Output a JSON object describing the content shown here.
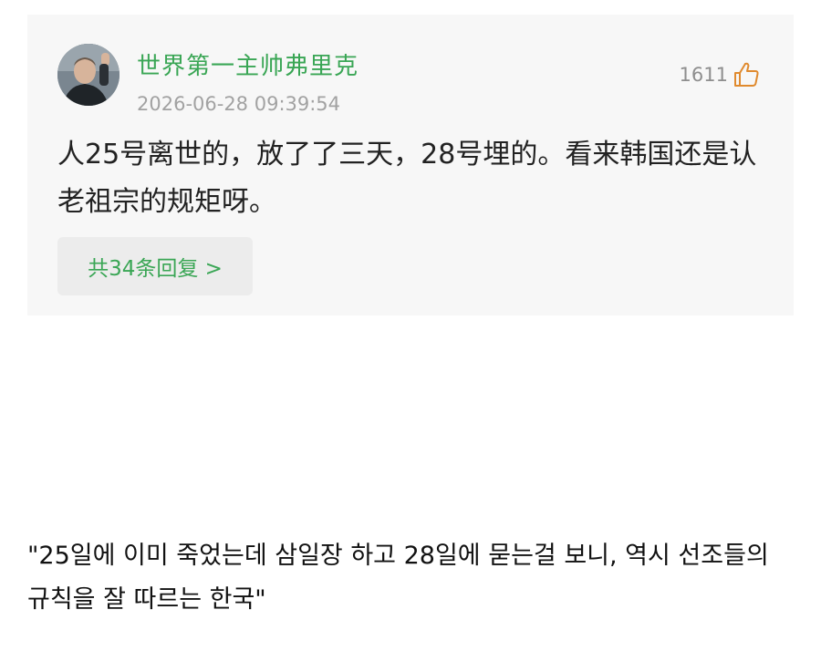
{
  "comment": {
    "username": "世界第一主帅弗里克",
    "timestamp": "2026-06-28 09:39:54",
    "like_count": "1611",
    "like_icon": "thumbs-up-icon",
    "avatar_icon": "user-avatar-photo",
    "text": "人25号离世的，放了了三天，28号埋的。看来韩国还是认老祖宗的规矩呀。",
    "reply_label": "共34条回复 >"
  },
  "translation": {
    "text": "\"25일에 이미 죽었는데 삼일장 하고 28일에 묻는걸 보니, 역시 선조들의 규칙을 잘 따르는 한국\""
  },
  "colors": {
    "accent_green": "#3aa655",
    "card_bg": "#f7f7f7",
    "reply_bg": "#ececec",
    "meta_gray": "#a2a2a2"
  }
}
